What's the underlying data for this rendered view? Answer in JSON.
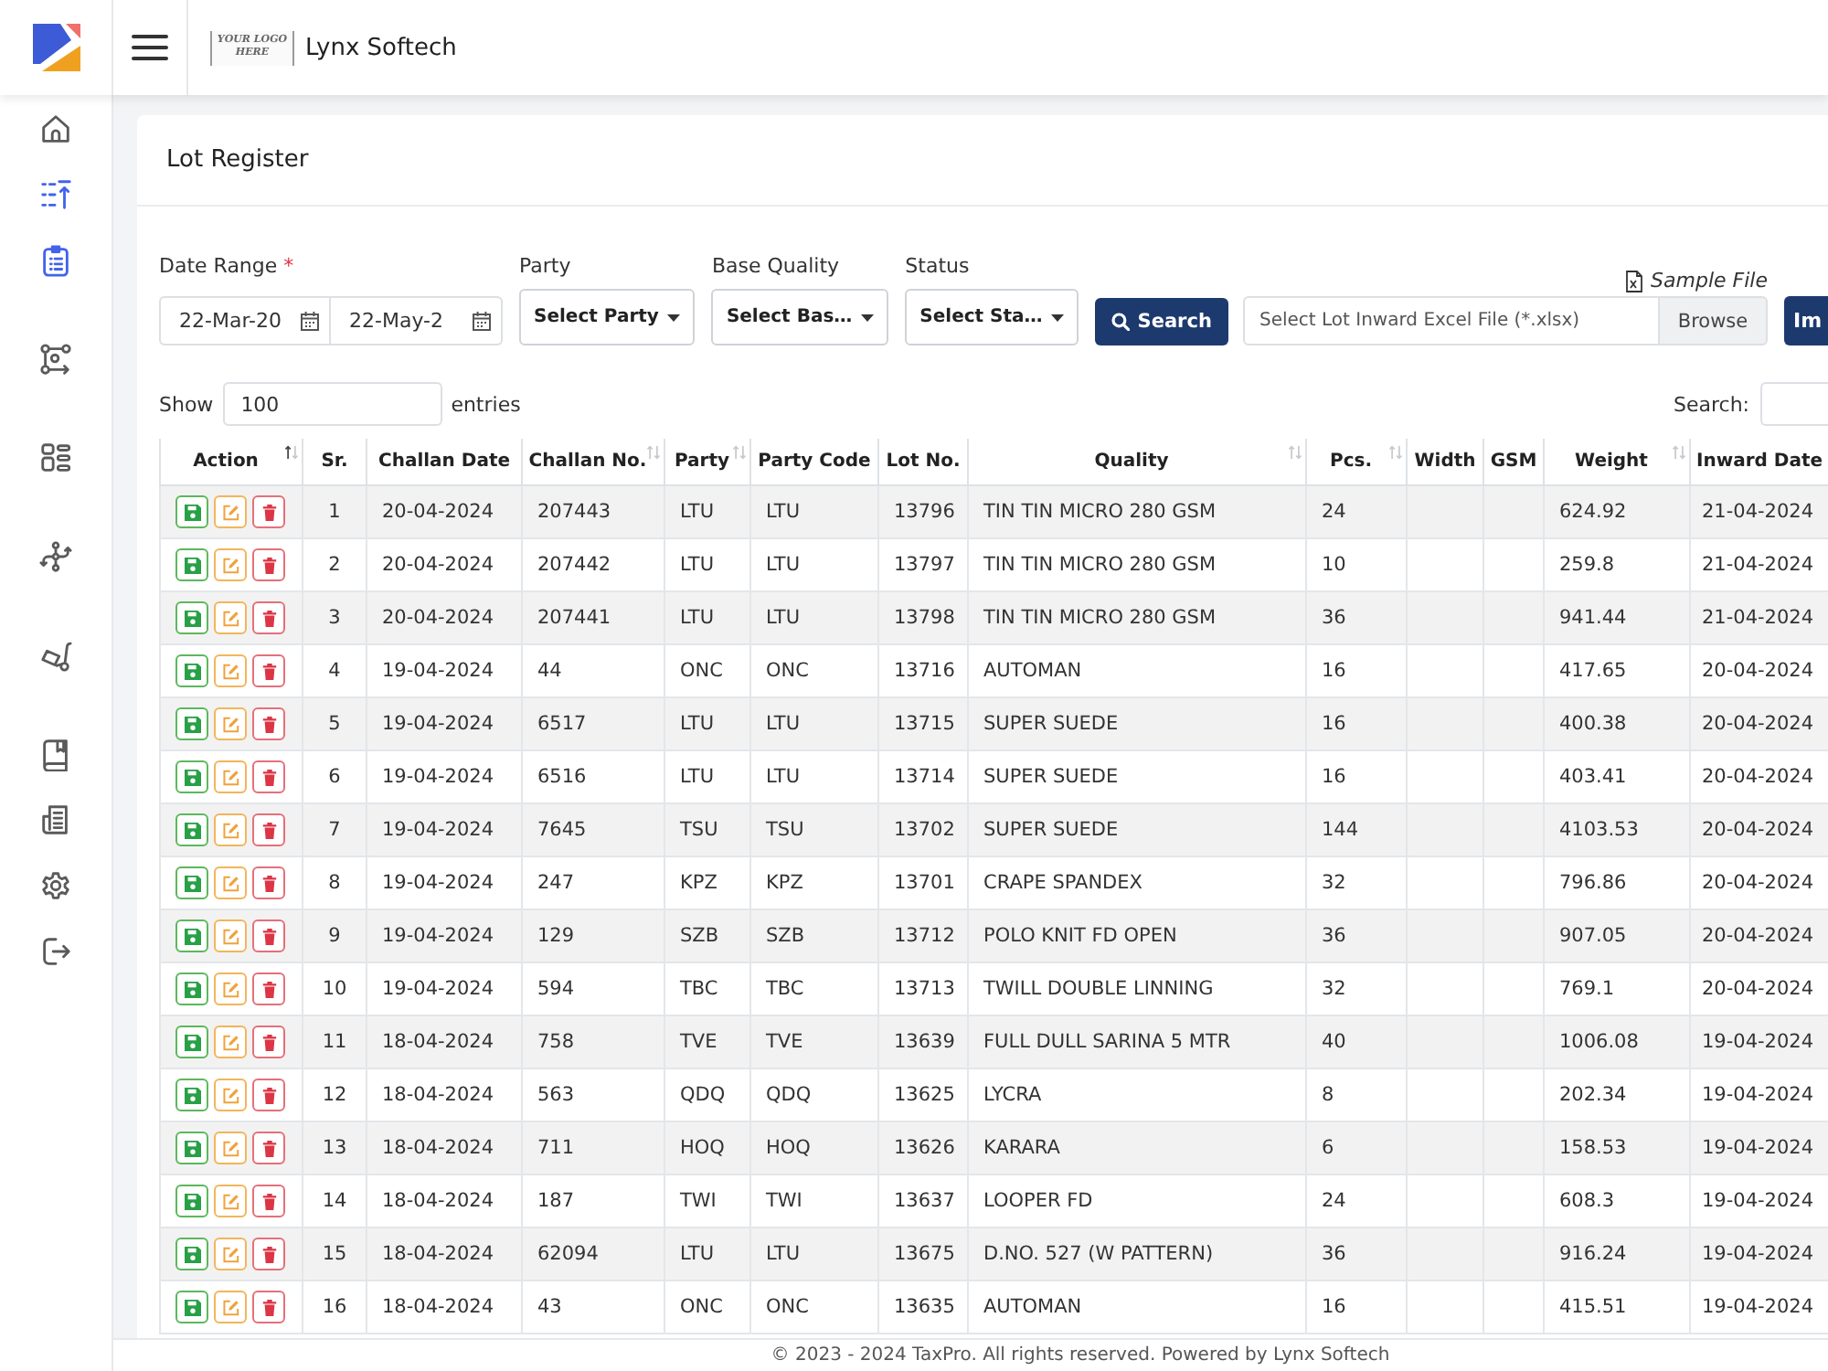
{
  "header": {
    "logo_text": "YOUR LOGO HERE",
    "company": "Lynx Softech"
  },
  "sidebar": {
    "items": [
      {
        "selected": false
      },
      {
        "selected": true
      },
      {
        "selected": true
      },
      {
        "selected": false
      },
      {
        "selected": false
      },
      {
        "selected": false
      },
      {
        "selected": false
      },
      {
        "selected": false
      },
      {
        "selected": false
      },
      {
        "selected": false
      },
      {
        "selected": false
      }
    ]
  },
  "page": {
    "title": "Lot Register"
  },
  "filters": {
    "date_range": {
      "label": "Date Range",
      "required_mark": "*",
      "from": "22-Mar-20",
      "to": "22-May-2"
    },
    "selects": [
      {
        "label": "Party",
        "value": "Select Party"
      },
      {
        "label": "Base Quality",
        "value": "Select Bas…"
      },
      {
        "label": "Status",
        "value": "Select Sta…"
      }
    ],
    "search_button": "Search"
  },
  "import": {
    "sample_link": "Sample File",
    "file_field": {
      "placeholder": "Select Lot Inward Excel File (*.xlsx)"
    },
    "browse_button": "Browse",
    "import_button": "Im"
  },
  "table_controls": {
    "show_label": "Show",
    "page_size": "100",
    "entries_label": "entries",
    "search_label": "Search:"
  },
  "table": {
    "columns": [
      {
        "label": "Action",
        "sortable": true,
        "sorted": true
      },
      {
        "label": "Sr.",
        "sortable": false,
        "sorted": false
      },
      {
        "label": "Challan Date",
        "sortable": false,
        "sorted": false
      },
      {
        "label": "Challan No.",
        "sortable": true,
        "sorted": false
      },
      {
        "label": "Party",
        "sortable": true,
        "sorted": false
      },
      {
        "label": "Party Code",
        "sortable": false,
        "sorted": false
      },
      {
        "label": "Lot No.",
        "sortable": false,
        "sorted": false
      },
      {
        "label": "Quality",
        "sortable": true,
        "sorted": false
      },
      {
        "label": "Pcs.",
        "sortable": true,
        "sorted": false
      },
      {
        "label": "Width",
        "sortable": false,
        "sorted": false
      },
      {
        "label": "GSM",
        "sortable": false,
        "sorted": false
      },
      {
        "label": "Weight",
        "sortable": true,
        "sorted": false
      },
      {
        "label": "Inward Date",
        "sortable": false,
        "sorted": false
      }
    ],
    "rows": [
      {
        "sr": "1",
        "challan_date": "20-04-2024",
        "challan_no": "207443",
        "party": "LTU",
        "party_code": "LTU",
        "lot_no": "13796",
        "quality": "TIN TIN MICRO 280 GSM",
        "pcs": "24",
        "weight": "624.92",
        "inward_date": "21-04-2024"
      },
      {
        "sr": "2",
        "challan_date": "20-04-2024",
        "challan_no": "207442",
        "party": "LTU",
        "party_code": "LTU",
        "lot_no": "13797",
        "quality": "TIN TIN MICRO 280 GSM",
        "pcs": "10",
        "weight": "259.8",
        "inward_date": "21-04-2024"
      },
      {
        "sr": "3",
        "challan_date": "20-04-2024",
        "challan_no": "207441",
        "party": "LTU",
        "party_code": "LTU",
        "lot_no": "13798",
        "quality": "TIN TIN MICRO 280 GSM",
        "pcs": "36",
        "weight": "941.44",
        "inward_date": "21-04-2024"
      },
      {
        "sr": "4",
        "challan_date": "19-04-2024",
        "challan_no": "44",
        "party": "ONC",
        "party_code": "ONC",
        "lot_no": "13716",
        "quality": "AUTOMAN",
        "pcs": "16",
        "weight": "417.65",
        "inward_date": "20-04-2024"
      },
      {
        "sr": "5",
        "challan_date": "19-04-2024",
        "challan_no": "6517",
        "party": "LTU",
        "party_code": "LTU",
        "lot_no": "13715",
        "quality": "SUPER SUEDE",
        "pcs": "16",
        "weight": "400.38",
        "inward_date": "20-04-2024"
      },
      {
        "sr": "6",
        "challan_date": "19-04-2024",
        "challan_no": "6516",
        "party": "LTU",
        "party_code": "LTU",
        "lot_no": "13714",
        "quality": "SUPER SUEDE",
        "pcs": "16",
        "weight": "403.41",
        "inward_date": "20-04-2024"
      },
      {
        "sr": "7",
        "challan_date": "19-04-2024",
        "challan_no": "7645",
        "party": "TSU",
        "party_code": "TSU",
        "lot_no": "13702",
        "quality": "SUPER SUEDE",
        "pcs": "144",
        "weight": "4103.53",
        "inward_date": "20-04-2024"
      },
      {
        "sr": "8",
        "challan_date": "19-04-2024",
        "challan_no": "247",
        "party": "KPZ",
        "party_code": "KPZ",
        "lot_no": "13701",
        "quality": "CRAPE SPANDEX",
        "pcs": "32",
        "weight": "796.86",
        "inward_date": "20-04-2024"
      },
      {
        "sr": "9",
        "challan_date": "19-04-2024",
        "challan_no": "129",
        "party": "SZB",
        "party_code": "SZB",
        "lot_no": "13712",
        "quality": "POLO KNIT FD OPEN",
        "pcs": "36",
        "weight": "907.05",
        "inward_date": "20-04-2024"
      },
      {
        "sr": "10",
        "challan_date": "19-04-2024",
        "challan_no": "594",
        "party": "TBC",
        "party_code": "TBC",
        "lot_no": "13713",
        "quality": "TWILL DOUBLE LINNING",
        "pcs": "32",
        "weight": "769.1",
        "inward_date": "20-04-2024"
      },
      {
        "sr": "11",
        "challan_date": "18-04-2024",
        "challan_no": "758",
        "party": "TVE",
        "party_code": "TVE",
        "lot_no": "13639",
        "quality": "FULL DULL SARINA 5 MTR",
        "pcs": "40",
        "weight": "1006.08",
        "inward_date": "19-04-2024"
      },
      {
        "sr": "12",
        "challan_date": "18-04-2024",
        "challan_no": "563",
        "party": "QDQ",
        "party_code": "QDQ",
        "lot_no": "13625",
        "quality": "LYCRA",
        "pcs": "8",
        "weight": "202.34",
        "inward_date": "19-04-2024"
      },
      {
        "sr": "13",
        "challan_date": "18-04-2024",
        "challan_no": "711",
        "party": "HOQ",
        "party_code": "HOQ",
        "lot_no": "13626",
        "quality": "KARARA",
        "pcs": "6",
        "weight": "158.53",
        "inward_date": "19-04-2024"
      },
      {
        "sr": "14",
        "challan_date": "18-04-2024",
        "challan_no": "187",
        "party": "TWI",
        "party_code": "TWI",
        "lot_no": "13637",
        "quality": "LOOPER FD",
        "pcs": "24",
        "weight": "608.3",
        "inward_date": "19-04-2024"
      },
      {
        "sr": "15",
        "challan_date": "18-04-2024",
        "challan_no": "62094",
        "party": "LTU",
        "party_code": "LTU",
        "lot_no": "13675",
        "quality": "D.NO. 527 (W PATTERN)",
        "pcs": "36",
        "weight": "916.24",
        "inward_date": "19-04-2024"
      },
      {
        "sr": "16",
        "challan_date": "18-04-2024",
        "challan_no": "43",
        "party": "ONC",
        "party_code": "ONC",
        "lot_no": "13635",
        "quality": "AUTOMAN",
        "pcs": "16",
        "weight": "415.51",
        "inward_date": "19-04-2024"
      }
    ]
  },
  "footer": "© 2023 - 2024 TaxPro. All rights reserved. Powered by Lynx Softech"
}
